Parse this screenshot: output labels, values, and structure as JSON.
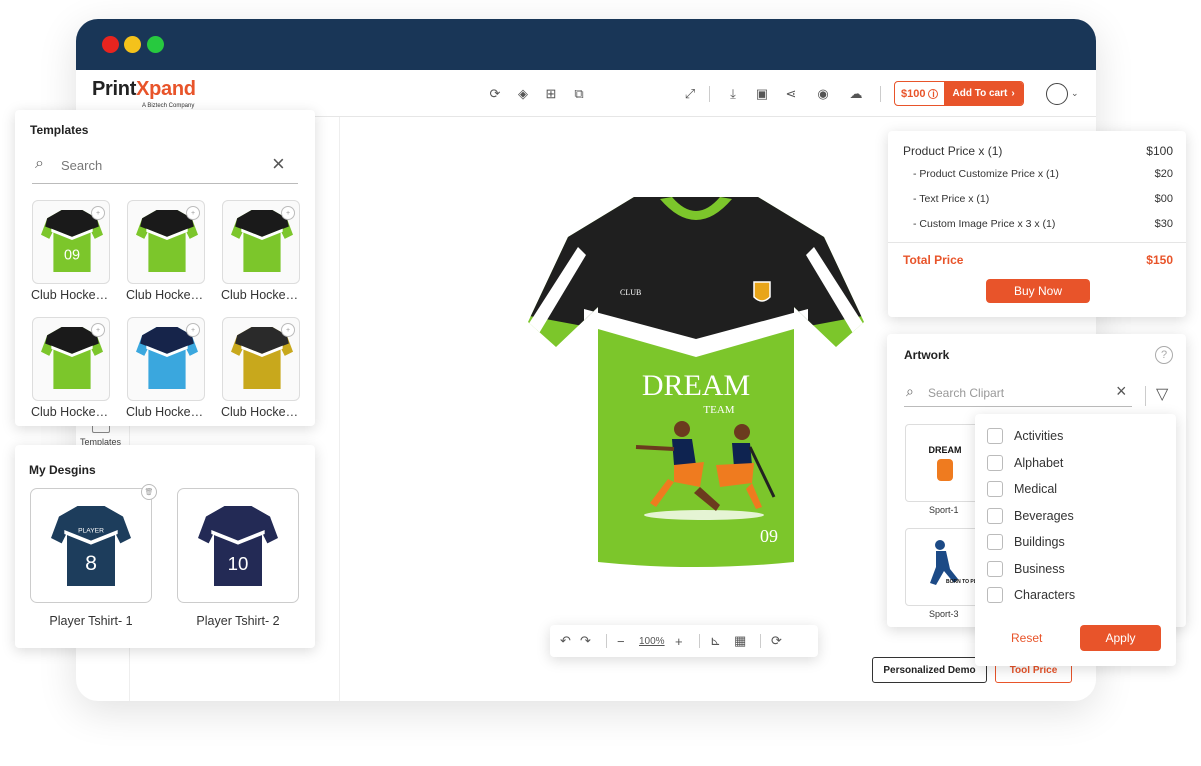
{
  "brand": {
    "logo_a": "Print",
    "logo_x": "X",
    "logo_b": "pand",
    "tagline": "A Biztech Company"
  },
  "toolbar": {
    "price": "$100",
    "price_icon": "info-icon",
    "add_to_cart": "Add To cart",
    "add_to_cart_icon": "chevron-right-icon"
  },
  "templates": {
    "title": "Templates",
    "search_placeholder": "Search",
    "items": [
      {
        "label": "Club Hockey Jersey",
        "color": "#7cc62b",
        "accent": "#1a1a1a"
      },
      {
        "label": "Club Hockey Jersey",
        "color": "#7cc62b",
        "accent": "#1a1a1a"
      },
      {
        "label": "Club Hockey Jersey",
        "color": "#7cc62b",
        "accent": "#1a1a1a"
      },
      {
        "label": "Club Hockey Jersey",
        "color": "#7cc62b",
        "accent": "#1a1a1a"
      },
      {
        "label": "Club Hockey Jersey",
        "color": "#3aa7de",
        "accent": "#16244a"
      },
      {
        "label": "Club Hockey Jersey",
        "color": "#c8a81c",
        "accent": "#2a2a2a"
      }
    ]
  },
  "rail": {
    "templates_label": "Templates"
  },
  "my_designs": {
    "title": "My Desgins",
    "items": [
      {
        "label": "Player Tshirt- 1",
        "text": "PLAYER",
        "number": "8",
        "color": "#1d3d5c"
      },
      {
        "label": "Player Tshirt- 2",
        "text": "",
        "number": "10",
        "color": "#232a55"
      }
    ]
  },
  "jersey": {
    "club": "CLUB",
    "title": "DREAM",
    "subtitle": "TEAM",
    "number": "09",
    "body_color": "#7cc62b",
    "top_color": "#1f1f1f"
  },
  "canvas_tools": {
    "zoom": "100%"
  },
  "pricing": {
    "product_price_label": "Product Price  x  (1)",
    "product_price": "$100",
    "lines": [
      {
        "label": "- Product Customize Price  x  (1)",
        "value": "$20"
      },
      {
        "label": "- Text Price x (1)",
        "value": "$00"
      },
      {
        "label": "- Custom Image Price x 3 x  (1)",
        "value": "$30"
      }
    ],
    "total_label": "Total Price",
    "total": "$150",
    "buy_now": "Buy Now"
  },
  "artwork": {
    "title": "Artwork",
    "search_placeholder": "Search Clipart",
    "items": [
      {
        "label": "Sport-1",
        "caption": "DREAM"
      },
      {
        "label": "Sport-3",
        "caption": "BORN TO PLAY"
      }
    ],
    "filter": {
      "options": [
        "Activities",
        "Alphabet",
        "Medical",
        "Beverages",
        "Buildings",
        "Business",
        "Characters"
      ],
      "reset": "Reset",
      "apply": "Apply"
    }
  },
  "bottom_buttons": {
    "demo": "Personalized Demo",
    "tool_price": "Tool Price"
  },
  "colors": {
    "accent": "#e8542a",
    "titlebar": "#193657"
  }
}
